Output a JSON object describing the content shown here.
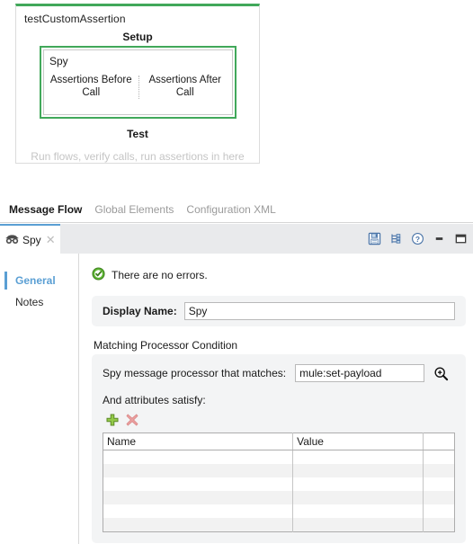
{
  "canvas": {
    "flow_name": "testCustomAssertion",
    "setup_label": "Setup",
    "spy": {
      "title": "Spy",
      "before_label": "Assertions Before Call",
      "after_label": "Assertions After Call"
    },
    "test_label": "Test",
    "test_hint": "Run flows, verify calls, run assertions in here"
  },
  "editor_tabs": [
    {
      "label": "Message Flow",
      "active": true
    },
    {
      "label": "Global Elements",
      "active": false
    },
    {
      "label": "Configuration XML",
      "active": false
    }
  ],
  "panel": {
    "tab": {
      "title": "Spy",
      "icon": "spy-glasses-icon",
      "close": "✕"
    },
    "tools": [
      {
        "name": "save-icon",
        "title": "Save"
      },
      {
        "name": "hierarchy-icon",
        "title": "Show hierarchy"
      },
      {
        "name": "help-icon",
        "title": "Help"
      },
      {
        "name": "minimize-icon",
        "title": "Minimize"
      },
      {
        "name": "maximize-icon",
        "title": "Maximize"
      }
    ],
    "nav": [
      {
        "label": "General",
        "active": true
      },
      {
        "label": "Notes",
        "active": false
      }
    ],
    "status": {
      "icon": "success-check-icon",
      "text": "There are no errors."
    },
    "display_name": {
      "label": "Display Name:",
      "value": "Spy",
      "placeholder": ""
    },
    "matching": {
      "legend": "Matching Processor Condition",
      "matcher_label": "Spy message processor that matches:",
      "matcher_value": "mule:set-payload",
      "matcher_placeholder": "",
      "browse_icon": "magnifier-plus-icon",
      "attributes_label": "And attributes satisfy:",
      "add_icon": "add-row-icon",
      "delete_icon": "delete-row-icon",
      "table": {
        "columns": [
          "Name",
          "Value",
          ""
        ],
        "rows": [
          [
            "",
            "",
            ""
          ],
          [
            "",
            "",
            ""
          ],
          [
            "",
            "",
            ""
          ],
          [
            "",
            "",
            ""
          ],
          [
            "",
            "",
            ""
          ],
          [
            "",
            "",
            ""
          ]
        ]
      }
    }
  },
  "colors": {
    "flow_green": "#41a85a",
    "accent_blue": "#5a9fd4",
    "panel_gray": "#e9eaec",
    "group_gray": "#f3f4f5",
    "success_green": "#5cb531"
  }
}
